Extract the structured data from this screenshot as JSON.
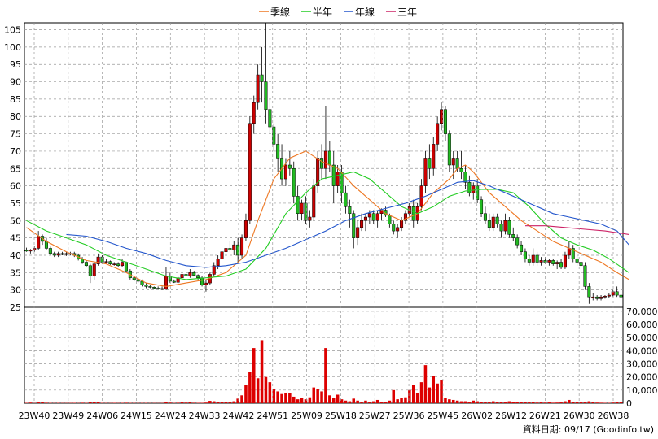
{
  "source_note": "資料日期: 09/17 (Goodinfo.tw)",
  "colors": {
    "up": "#cc0000",
    "down": "#22bb22",
    "volume": "#dd0000",
    "ma_quarter": "#ee7722",
    "ma_half": "#22cc22",
    "ma_year": "#2255cc",
    "ma_three": "#cc2266",
    "grid": "#999999"
  },
  "chart_data": {
    "type": "line",
    "legend": [
      {
        "name": "季線",
        "color": "#ee7722"
      },
      {
        "name": "半年",
        "color": "#22cc22"
      },
      {
        "name": "年線",
        "color": "#2255cc"
      },
      {
        "name": "三年",
        "color": "#cc2266"
      }
    ],
    "legend_position": "top-center",
    "grid": true,
    "x_ticks": [
      "23W40",
      "23W49",
      "24W06",
      "24W15",
      "24W24",
      "24W33",
      "24W42",
      "24W51",
      "25W09",
      "25W18",
      "25W27",
      "25W36",
      "25W45",
      "26W02",
      "26W12",
      "26W21",
      "26W30",
      "26W38"
    ],
    "price_axis": {
      "ylim": [
        25,
        107
      ],
      "ticks": [
        25,
        30,
        35,
        40,
        45,
        50,
        55,
        60,
        65,
        70,
        75,
        80,
        85,
        90,
        95,
        100,
        105
      ]
    },
    "volume_axis": {
      "ylim": [
        0,
        73000
      ],
      "ticks": [
        "0",
        "10,000",
        "20,000",
        "30,000",
        "40,000",
        "50,000",
        "60,000",
        "70,000"
      ]
    },
    "candles": [
      [
        41.5,
        42.2,
        41,
        41.2
      ],
      [
        41.2,
        41.8,
        40.5,
        41.5
      ],
      [
        41.5,
        42.5,
        41,
        42
      ],
      [
        42,
        47,
        41.5,
        45.5
      ],
      [
        45.5,
        46,
        43,
        44
      ],
      [
        44,
        45,
        41.5,
        42
      ],
      [
        42,
        42.5,
        40,
        40.5
      ],
      [
        40.5,
        41,
        39.5,
        40
      ],
      [
        40,
        41,
        39.5,
        40.5
      ],
      [
        40.5,
        41,
        40,
        40.2
      ],
      [
        40.2,
        41,
        39.8,
        40.5
      ],
      [
        40.5,
        41,
        40,
        40.5
      ],
      [
        40.5,
        41,
        39.5,
        40
      ],
      [
        40,
        40.5,
        38.5,
        39
      ],
      [
        39,
        39.5,
        37.5,
        38
      ],
      [
        38,
        38.5,
        36.5,
        37
      ],
      [
        37,
        37.5,
        32,
        34
      ],
      [
        34,
        38,
        33,
        37.5
      ],
      [
        37.5,
        40.5,
        37,
        39.5
      ],
      [
        39.5,
        40,
        37.5,
        38
      ],
      [
        38,
        39,
        37.5,
        38.2
      ],
      [
        38.2,
        38.5,
        37.2,
        37.5
      ],
      [
        37.5,
        38,
        37,
        37.5
      ],
      [
        37.5,
        38,
        36.5,
        37
      ],
      [
        37,
        39,
        36.5,
        38
      ],
      [
        38,
        38.2,
        35,
        35.5
      ],
      [
        35.5,
        36,
        33,
        33.5
      ],
      [
        33.5,
        34,
        32.5,
        33
      ],
      [
        33,
        33.5,
        32,
        32.5
      ],
      [
        32.5,
        33,
        31,
        31.5
      ],
      [
        31.5,
        32,
        30.5,
        31
      ],
      [
        31,
        31.5,
        30.5,
        30.8
      ],
      [
        30.8,
        31,
        30.2,
        30.5
      ],
      [
        30.5,
        31,
        30.2,
        30.4
      ],
      [
        30.4,
        31,
        30,
        30.2
      ],
      [
        30.2,
        36.5,
        30,
        34
      ],
      [
        34,
        35,
        32,
        32.5
      ],
      [
        32.5,
        33,
        32,
        32.2
      ],
      [
        32.2,
        34,
        31.5,
        33.5
      ],
      [
        33.5,
        35,
        33,
        34.5
      ],
      [
        34.5,
        35,
        33.5,
        34
      ],
      [
        34,
        36,
        33.5,
        35
      ],
      [
        35,
        35.5,
        34,
        34.2
      ],
      [
        34.2,
        34.5,
        33,
        33.5
      ],
      [
        33.5,
        34,
        31,
        31.5
      ],
      [
        31.5,
        33,
        29.5,
        32
      ],
      [
        32,
        35,
        31.5,
        34.5
      ],
      [
        34.5,
        38,
        34,
        37
      ],
      [
        37,
        40,
        36,
        39
      ],
      [
        39,
        42,
        38,
        41
      ],
      [
        41,
        43,
        40,
        42
      ],
      [
        42,
        44,
        41,
        41.5
      ],
      [
        41.5,
        44,
        40,
        43
      ],
      [
        43,
        45,
        38,
        40
      ],
      [
        40,
        46,
        39,
        45
      ],
      [
        45,
        52,
        44,
        50
      ],
      [
        50,
        80,
        49,
        78
      ],
      [
        78,
        86,
        75,
        84
      ],
      [
        84,
        95,
        82,
        92
      ],
      [
        92,
        100,
        84,
        90
      ],
      [
        90,
        107,
        78,
        82
      ],
      [
        82,
        85,
        75,
        77
      ],
      [
        77,
        78,
        70,
        72
      ],
      [
        72,
        75,
        64,
        68
      ],
      [
        68,
        72,
        60,
        62
      ],
      [
        62,
        68,
        60,
        66
      ],
      [
        66,
        70,
        63,
        65
      ],
      [
        65,
        67,
        55,
        57
      ],
      [
        57,
        60,
        50,
        52
      ],
      [
        52,
        56,
        50,
        55
      ],
      [
        55,
        57,
        49,
        50
      ],
      [
        50,
        53,
        48,
        51
      ],
      [
        51,
        62,
        50,
        60
      ],
      [
        60,
        70,
        58,
        68
      ],
      [
        68,
        72,
        62,
        65
      ],
      [
        65,
        83,
        62,
        70
      ],
      [
        70,
        73,
        64,
        66
      ],
      [
        66,
        70,
        55,
        60
      ],
      [
        60,
        66,
        58,
        64
      ],
      [
        64,
        66,
        55,
        58
      ],
      [
        58,
        60,
        52,
        54
      ],
      [
        54,
        56,
        48,
        52
      ],
      [
        52,
        53,
        42,
        45
      ],
      [
        45,
        50,
        43,
        48
      ],
      [
        48,
        52,
        47,
        50
      ],
      [
        50,
        52,
        47,
        51
      ],
      [
        51,
        53,
        49,
        52
      ],
      [
        52,
        53,
        49,
        50
      ],
      [
        50,
        53,
        48,
        52
      ],
      [
        52,
        53.5,
        50,
        53
      ],
      [
        53,
        54,
        51,
        51.5
      ],
      [
        51.5,
        52,
        48,
        49
      ],
      [
        49,
        50,
        46,
        47
      ],
      [
        47,
        49,
        45,
        48
      ],
      [
        48,
        51,
        47,
        50
      ],
      [
        50,
        53,
        49,
        52
      ],
      [
        52,
        55,
        51,
        54
      ],
      [
        54,
        56,
        48,
        50
      ],
      [
        50,
        55,
        49,
        54
      ],
      [
        54,
        62,
        53,
        60
      ],
      [
        60,
        70,
        58,
        68
      ],
      [
        68,
        72,
        62,
        65
      ],
      [
        65,
        74,
        63,
        72
      ],
      [
        72,
        80,
        70,
        78
      ],
      [
        78,
        84,
        76,
        82
      ],
      [
        82,
        83,
        73,
        75
      ],
      [
        75,
        76,
        64,
        66
      ],
      [
        66,
        70,
        62,
        68
      ],
      [
        68,
        70,
        64,
        65
      ],
      [
        65,
        70,
        62,
        64
      ],
      [
        64,
        66,
        59,
        61
      ],
      [
        61,
        63,
        57,
        58
      ],
      [
        58,
        61,
        56,
        60
      ],
      [
        60,
        62,
        55,
        56
      ],
      [
        56,
        57,
        51,
        52
      ],
      [
        52,
        54,
        49,
        50
      ],
      [
        50,
        52,
        47,
        48
      ],
      [
        48,
        52,
        47,
        51
      ],
      [
        51,
        52,
        48,
        49
      ],
      [
        49,
        50,
        45,
        47
      ],
      [
        47,
        52,
        46,
        50
      ],
      [
        50,
        51,
        45,
        46
      ],
      [
        46,
        48,
        44,
        45
      ],
      [
        45,
        46,
        42,
        43
      ],
      [
        43,
        44,
        40,
        41
      ],
      [
        41,
        42,
        38,
        39
      ],
      [
        39,
        40,
        37,
        38
      ],
      [
        38,
        42,
        37,
        40
      ],
      [
        40,
        41,
        37,
        38
      ],
      [
        38,
        39.5,
        37,
        38.5
      ],
      [
        38.5,
        39.5,
        37.5,
        38
      ],
      [
        38,
        39,
        37,
        38.5
      ],
      [
        38.5,
        39,
        37,
        37.5
      ],
      [
        37.5,
        38.5,
        36,
        38
      ],
      [
        38,
        39,
        36,
        36.5
      ],
      [
        36.5,
        41,
        36,
        40
      ],
      [
        40,
        44,
        39,
        42
      ],
      [
        42,
        43,
        38,
        39
      ],
      [
        39,
        40,
        37,
        38
      ],
      [
        38,
        39,
        36,
        37
      ],
      [
        37,
        38,
        30,
        31
      ],
      [
        31,
        32,
        26,
        28
      ],
      [
        28,
        29,
        27,
        28
      ],
      [
        28,
        28.5,
        27,
        27.5
      ],
      [
        27.5,
        28.5,
        27,
        28
      ],
      [
        28,
        28.5,
        27.5,
        28.2
      ],
      [
        28.2,
        29,
        27.8,
        28.5
      ],
      [
        28.5,
        30,
        28,
        29.5
      ],
      [
        29.5,
        31,
        28,
        28.5
      ],
      [
        28.5,
        29,
        27.5,
        28
      ]
    ],
    "volume": [
      300,
      500,
      200,
      600,
      900,
      400,
      300,
      200,
      300,
      200,
      200,
      250,
      300,
      200,
      400,
      300,
      900,
      800,
      700,
      300,
      250,
      200,
      300,
      200,
      300,
      400,
      300,
      250,
      200,
      250,
      300,
      200,
      200,
      150,
      200,
      900,
      500,
      300,
      400,
      600,
      500,
      800,
      400,
      300,
      300,
      500,
      1800,
      1500,
      1200,
      900,
      700,
      1000,
      1500,
      3500,
      6000,
      14000,
      24000,
      42000,
      19000,
      48000,
      20000,
      16000,
      11000,
      9000,
      7000,
      8000,
      7500,
      5000,
      3000,
      4000,
      3000,
      4500,
      12000,
      11000,
      9000,
      42000,
      6000,
      4000,
      6500,
      3000,
      2000,
      1500,
      3500,
      2000,
      1200,
      2000,
      1000,
      1500,
      2500,
      1200,
      1000,
      2000,
      10000,
      3000,
      4000,
      4500,
      10000,
      14000,
      8000,
      16000,
      29000,
      12000,
      21000,
      15000,
      17500,
      4000,
      3000,
      2500,
      2000,
      1500,
      1500,
      1200,
      2000,
      1500,
      1200,
      1000,
      800,
      1500,
      1200,
      800,
      1000,
      1500,
      800,
      1000,
      800,
      900,
      600,
      700,
      500,
      600,
      500,
      600,
      400,
      500,
      600,
      1500,
      2500,
      1000,
      800,
      600,
      1200,
      1500,
      800,
      500,
      400,
      300,
      300,
      500,
      1000,
      600
    ],
    "ma_quarter": [
      [
        0,
        48
      ],
      [
        5,
        44
      ],
      [
        10,
        41
      ],
      [
        15,
        38.5
      ],
      [
        20,
        37.5
      ],
      [
        25,
        35
      ],
      [
        30,
        32
      ],
      [
        35,
        31
      ],
      [
        40,
        32
      ],
      [
        45,
        33
      ],
      [
        50,
        35
      ],
      [
        55,
        40
      ],
      [
        58,
        50
      ],
      [
        62,
        62
      ],
      [
        66,
        68
      ],
      [
        70,
        70
      ],
      [
        74,
        67
      ],
      [
        78,
        65
      ],
      [
        82,
        60
      ],
      [
        86,
        56
      ],
      [
        90,
        52
      ],
      [
        94,
        50
      ],
      [
        98,
        52
      ],
      [
        102,
        58
      ],
      [
        106,
        62
      ],
      [
        108,
        65
      ],
      [
        110,
        66
      ],
      [
        112,
        64
      ],
      [
        116,
        58
      ],
      [
        120,
        54
      ],
      [
        124,
        50
      ],
      [
        128,
        47
      ],
      [
        132,
        44
      ],
      [
        136,
        42
      ],
      [
        140,
        40
      ],
      [
        144,
        38
      ],
      [
        148,
        35
      ],
      [
        151,
        33
      ]
    ],
    "ma_half": [
      [
        0,
        50
      ],
      [
        5,
        47
      ],
      [
        10,
        45
      ],
      [
        15,
        43
      ],
      [
        20,
        40
      ],
      [
        25,
        38
      ],
      [
        30,
        36
      ],
      [
        35,
        34
      ],
      [
        40,
        33
      ],
      [
        45,
        33.5
      ],
      [
        50,
        34
      ],
      [
        55,
        36
      ],
      [
        60,
        42
      ],
      [
        65,
        52
      ],
      [
        70,
        58
      ],
      [
        74,
        62
      ],
      [
        78,
        63
      ],
      [
        82,
        64
      ],
      [
        86,
        62
      ],
      [
        90,
        58
      ],
      [
        94,
        54
      ],
      [
        98,
        52
      ],
      [
        102,
        54
      ],
      [
        106,
        57
      ],
      [
        110,
        58.5
      ],
      [
        114,
        59
      ],
      [
        118,
        59
      ],
      [
        122,
        58
      ],
      [
        126,
        54
      ],
      [
        130,
        49
      ],
      [
        134,
        45
      ],
      [
        138,
        43
      ],
      [
        142,
        41.5
      ],
      [
        146,
        39
      ],
      [
        151,
        35
      ]
    ],
    "ma_year": [
      [
        10,
        46
      ],
      [
        15,
        45.5
      ],
      [
        20,
        44
      ],
      [
        25,
        42
      ],
      [
        30,
        40.5
      ],
      [
        35,
        38.5
      ],
      [
        40,
        37
      ],
      [
        45,
        36.5
      ],
      [
        50,
        37
      ],
      [
        55,
        38
      ],
      [
        60,
        40
      ],
      [
        65,
        42
      ],
      [
        70,
        44.5
      ],
      [
        75,
        47
      ],
      [
        80,
        50
      ],
      [
        85,
        52
      ],
      [
        90,
        53.5
      ],
      [
        95,
        55
      ],
      [
        100,
        57
      ],
      [
        104,
        59
      ],
      [
        108,
        61
      ],
      [
        112,
        61.5
      ],
      [
        116,
        60
      ],
      [
        120,
        58
      ],
      [
        124,
        56
      ],
      [
        128,
        54
      ],
      [
        132,
        52
      ],
      [
        136,
        51
      ],
      [
        140,
        50
      ],
      [
        144,
        49
      ],
      [
        148,
        47
      ],
      [
        151,
        43
      ]
    ],
    "ma_three": [
      [
        125,
        48.5
      ],
      [
        130,
        48.5
      ],
      [
        135,
        48
      ],
      [
        140,
        47.5
      ],
      [
        145,
        47
      ],
      [
        151,
        46
      ]
    ]
  }
}
